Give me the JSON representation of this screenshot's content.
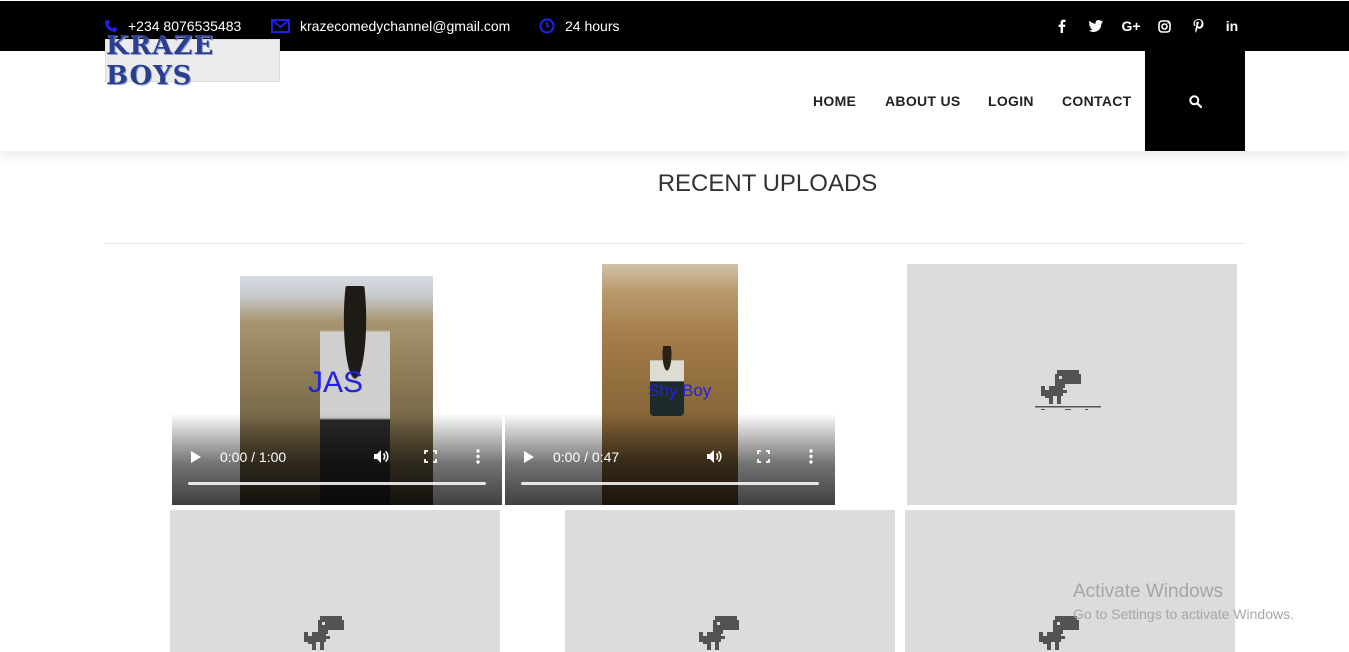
{
  "topbar": {
    "phone": "+234 8076535483",
    "email": "krazecomedychannel@gmail.com",
    "hours": "24 hours",
    "social": [
      {
        "name": "facebook-icon",
        "glyph": "f"
      },
      {
        "name": "twitter-icon",
        "glyph": "t"
      },
      {
        "name": "google-plus-icon",
        "glyph": "G+"
      },
      {
        "name": "instagram-icon",
        "glyph": "ig"
      },
      {
        "name": "pinterest-icon",
        "glyph": "p"
      },
      {
        "name": "linkedin-icon",
        "glyph": "in"
      }
    ],
    "icon_color": "#1f1fe0"
  },
  "header": {
    "logo_text": "KRAZE BOYS",
    "nav": [
      "HOME",
      "ABOUT US",
      "LOGIN",
      "CONTACT"
    ]
  },
  "section": {
    "title": "RECENT UPLOADS"
  },
  "videos": [
    {
      "time": "0:00 / 1:00",
      "overlay": "JAS"
    },
    {
      "time": "0:00 / 0:47",
      "overlay": "Shy Boy"
    }
  ],
  "watermark": {
    "line1": "Activate Windows",
    "line2": "Go to Settings to activate Windows."
  }
}
